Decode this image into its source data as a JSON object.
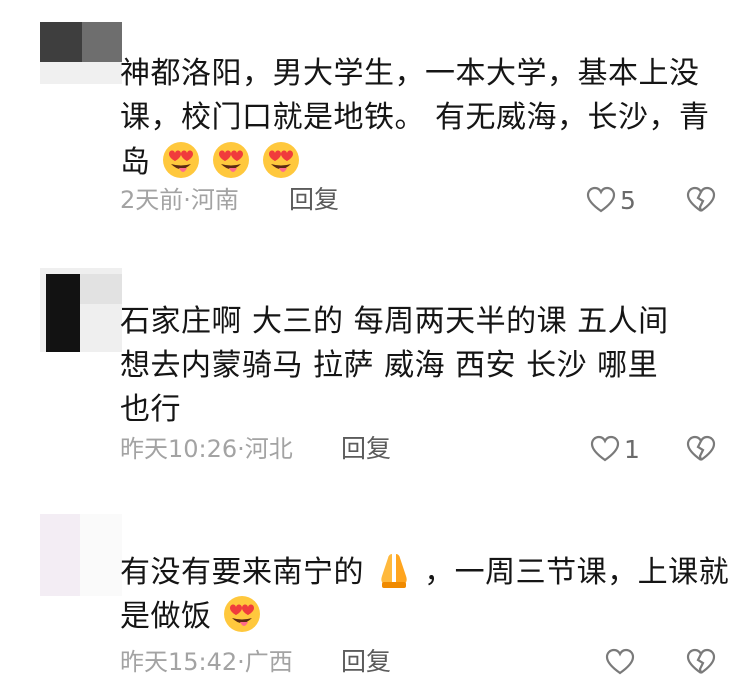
{
  "comments": [
    {
      "lines": [
        "神都洛阳，男大学生，一本大学，基本上没",
        "课，校门口就是地铁。 有无威海，长沙，青",
        "岛"
      ],
      "trailing_emojis": [
        "heart-eyes-tongue-emoji",
        "heart-eyes-tongue-emoji",
        "heart-eyes-tongue-emoji"
      ],
      "meta": "2天前·河南",
      "reply_label": "回复",
      "like_count": "5"
    },
    {
      "lines": [
        "石家庄啊  大三的  每周两天半的课  五人间",
        "想去内蒙骑马  拉萨  威海  西安  长沙  哪里",
        "也行"
      ],
      "meta": "昨天10:26·河北",
      "reply_label": "回复",
      "like_count": "1"
    },
    {
      "line1_before": "有没有要来南宁的",
      "line1_after": "，一周三节课，上课就",
      "line2": "是做饭",
      "inline_emoji": "praying-hands-emoji",
      "trailing_emoji": "heart-eyes-tongue-emoji",
      "meta": "昨天15:42·广西",
      "reply_label": "回复",
      "like_count": ""
    }
  ],
  "colors": {
    "text": "#151515",
    "meta": "#a3a3a3",
    "reply": "#5b5b5b",
    "icon": "#7a7a7a"
  }
}
